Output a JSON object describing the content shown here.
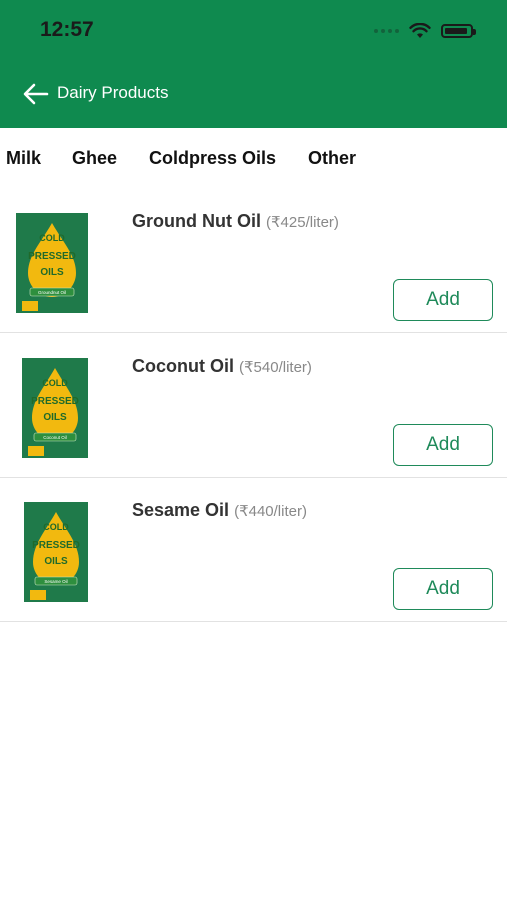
{
  "status_bar": {
    "time": "12:57"
  },
  "header": {
    "title": "Dairy Products"
  },
  "tabs": [
    {
      "label": "Milk"
    },
    {
      "label": "Ghee"
    },
    {
      "label": "Coldpress Oils"
    },
    {
      "label": "Other"
    }
  ],
  "products": [
    {
      "name": "Ground Nut Oil",
      "price": "(₹425/liter)",
      "button_label": "Add",
      "image_text": [
        "COLD",
        "PRESSED",
        "OILS"
      ],
      "image_label": "Groundnut Oil"
    },
    {
      "name": "Coconut Oil",
      "price": "(₹540/liter)",
      "button_label": "Add",
      "image_text": [
        "COLD",
        "PRESSED",
        "OILS"
      ],
      "image_label": "Coconut Oil"
    },
    {
      "name": "Sesame Oil",
      "price": "(₹440/liter)",
      "button_label": "Add",
      "image_text": [
        "COLD",
        "PRESSED",
        "OILS"
      ],
      "image_label": "Sesame Oil"
    }
  ],
  "colors": {
    "header": "#0f8a4f",
    "accent": "#1f8a5a"
  }
}
